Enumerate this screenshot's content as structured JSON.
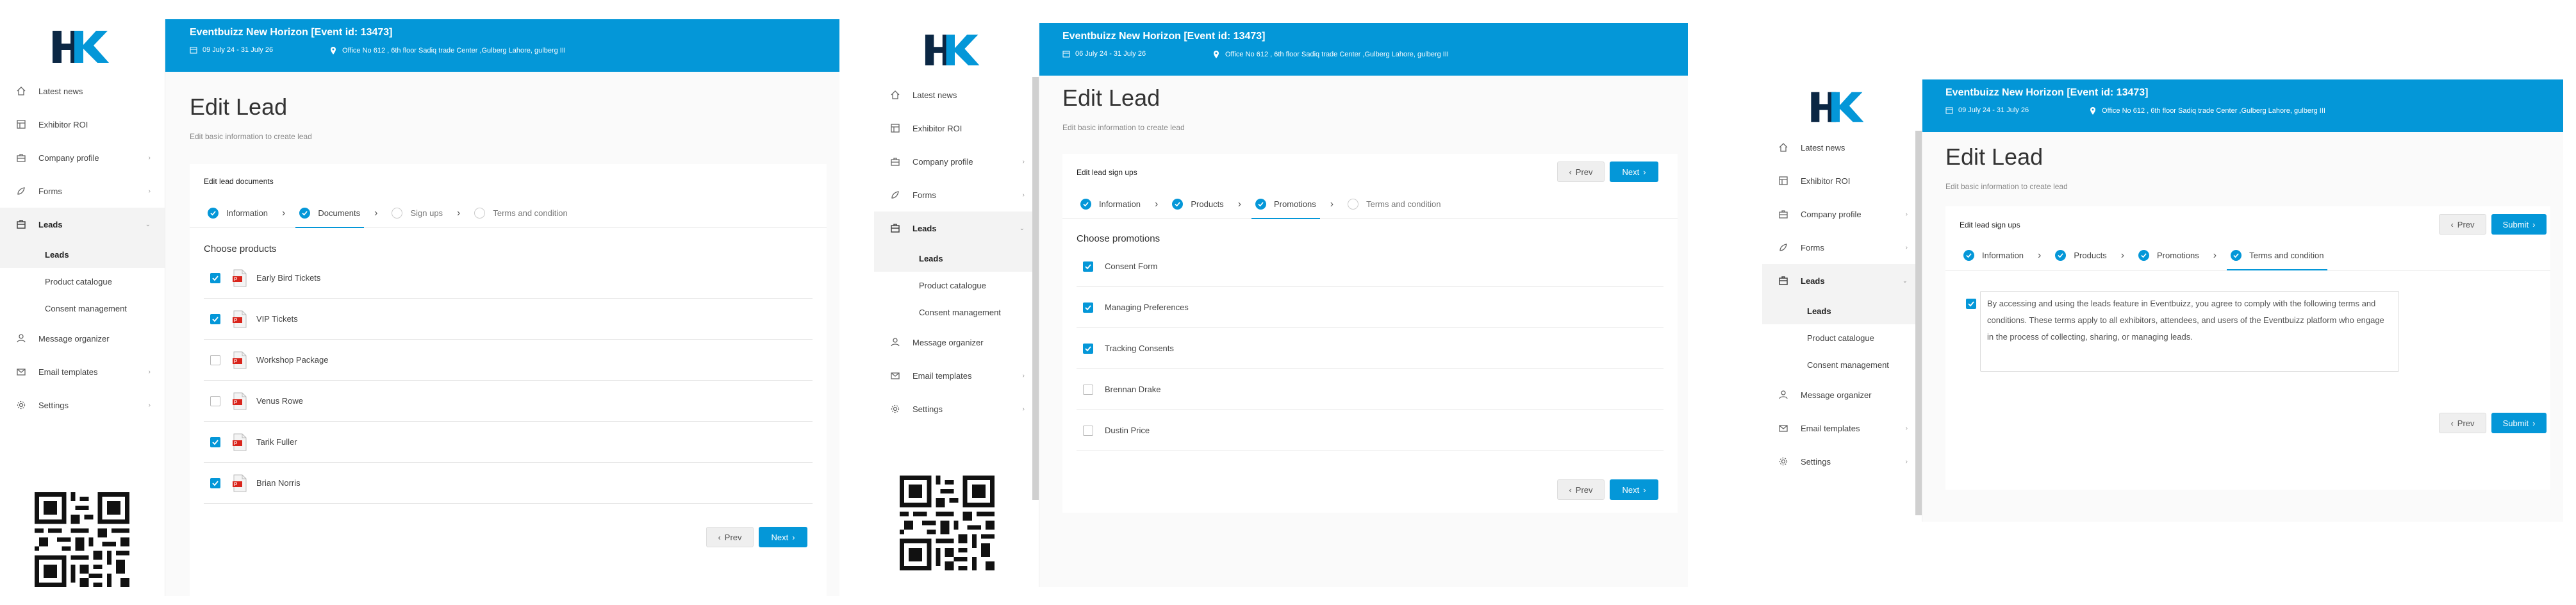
{
  "brand": {
    "logo": "HK",
    "accent": "#0497d8"
  },
  "event": {
    "title": "Eventbuizz New Horizon [Event id: 13473]",
    "address": "Office No 612 , 6th floor Sadiq trade Center ,Gulberg Lahore, gulberg III"
  },
  "sidebar": {
    "items": [
      "Latest news",
      "Exhibitor ROI",
      "Company profile",
      "Forms",
      "Leads",
      "Message organizer",
      "Email templates",
      "Settings"
    ],
    "sub": [
      "Leads",
      "Product catalogue",
      "Consent management"
    ]
  },
  "page": {
    "title": "Edit Lead",
    "subtitle": "Edit basic information to create lead"
  },
  "buttons": {
    "prev": "Prev",
    "next": "Next",
    "submit": "Submit"
  },
  "screen1": {
    "date": "09 July 24 - 31 July 26",
    "card_title": "Edit lead documents",
    "steps": [
      "Information",
      "Documents",
      "Sign ups",
      "Terms and condition"
    ],
    "section": "Choose products",
    "items": [
      {
        "label": "Early Bird Tickets",
        "checked": true
      },
      {
        "label": "VIP Tickets",
        "checked": true
      },
      {
        "label": "Workshop Package",
        "checked": false
      },
      {
        "label": "Venus Rowe",
        "checked": false
      },
      {
        "label": "Tarik Fuller",
        "checked": true
      },
      {
        "label": "Brian Norris",
        "checked": true
      }
    ]
  },
  "screen2": {
    "date": "06 July 24 - 31 July 26",
    "card_title": "Edit lead sign ups",
    "steps": [
      "Information",
      "Products",
      "Promotions",
      "Terms and condition"
    ],
    "section": "Choose promotions",
    "items": [
      {
        "label": "Consent Form",
        "checked": true
      },
      {
        "label": "Managing Preferences",
        "checked": true
      },
      {
        "label": "Tracking Consents",
        "checked": true
      },
      {
        "label": "Brennan Drake",
        "checked": false
      },
      {
        "label": "Dustin Price",
        "checked": false
      }
    ]
  },
  "screen3": {
    "date": "09 July 24 - 31 July 26",
    "card_title": "Edit lead sign ups",
    "steps": [
      "Information",
      "Products",
      "Promotions",
      "Terms and condition"
    ],
    "terms_text": "By accessing and using the leads feature in Eventbuizz, you agree to comply with the following terms and conditions. These terms apply to all exhibitors, attendees, and users of the Eventbuizz platform who engage in the process of collecting, sharing, or managing leads.",
    "terms_checked": true
  }
}
